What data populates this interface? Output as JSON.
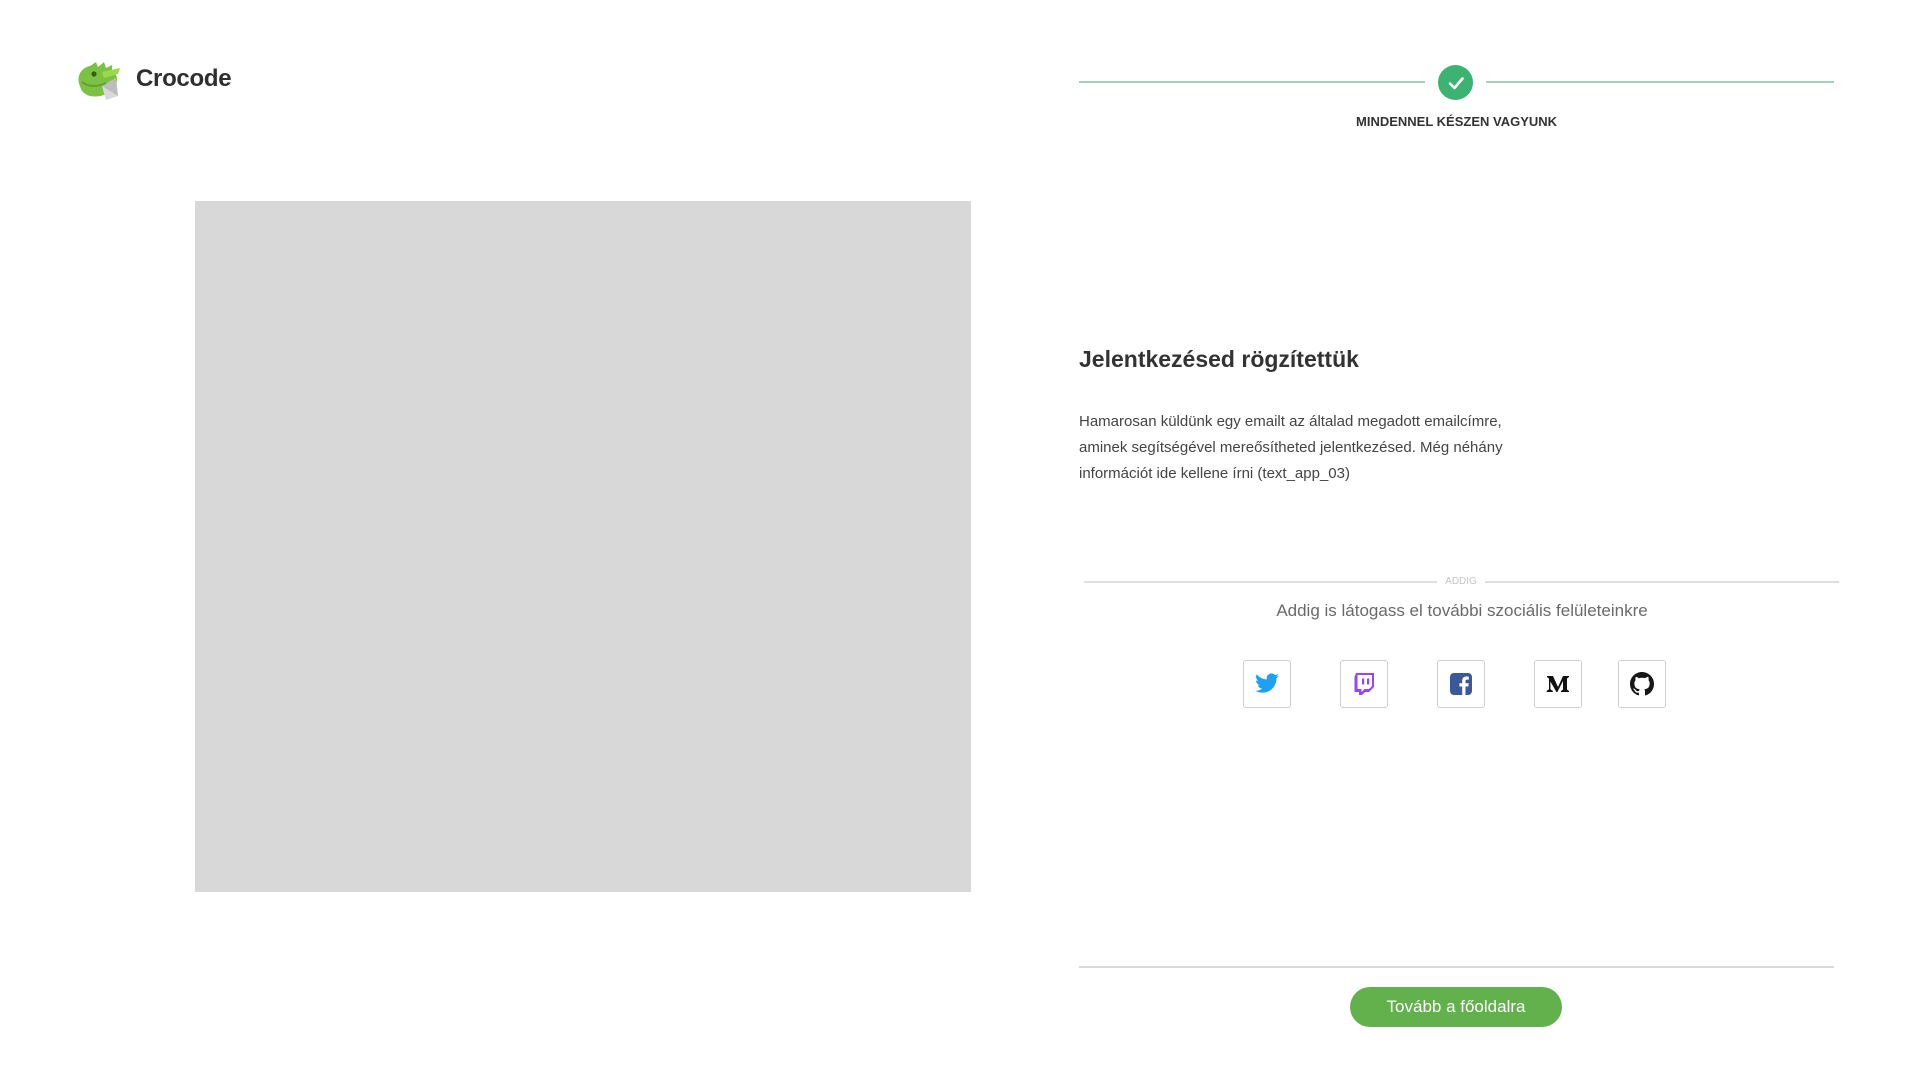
{
  "brand": {
    "name": "Crocode",
    "logo_icon": "crocodile-logo-icon"
  },
  "stepper": {
    "label": "MINDENNEL KÉSZEN VAGYUNK",
    "icon": "checkmark-icon",
    "color": "#3cb371"
  },
  "main": {
    "headline": "Jelentkezésed rögzítettük",
    "message": "Hamarosan küldünk egy emailt az általad megadott emailcímre, aminek segítségével mereősítheted jelentkezésed. Még néhány információt ide kellene írni (text_app_03)"
  },
  "divider": {
    "text": "ADDIG"
  },
  "social": {
    "caption": "Addig is látogass el további szociális felületeinkre",
    "links": [
      {
        "name": "Twitter",
        "icon": "twitter-icon",
        "color": "#1da1f2"
      },
      {
        "name": "Twitch",
        "icon": "twitch-icon",
        "color": "#9146ff"
      },
      {
        "name": "Facebook",
        "icon": "facebook-icon",
        "color": "#3b5998"
      },
      {
        "name": "Medium",
        "icon": "medium-icon",
        "color": "#000000"
      },
      {
        "name": "GitHub",
        "icon": "github-icon",
        "color": "#181717"
      }
    ]
  },
  "footer": {
    "cta_label": "Tovább a főoldalra",
    "accent": "#62b14c"
  }
}
